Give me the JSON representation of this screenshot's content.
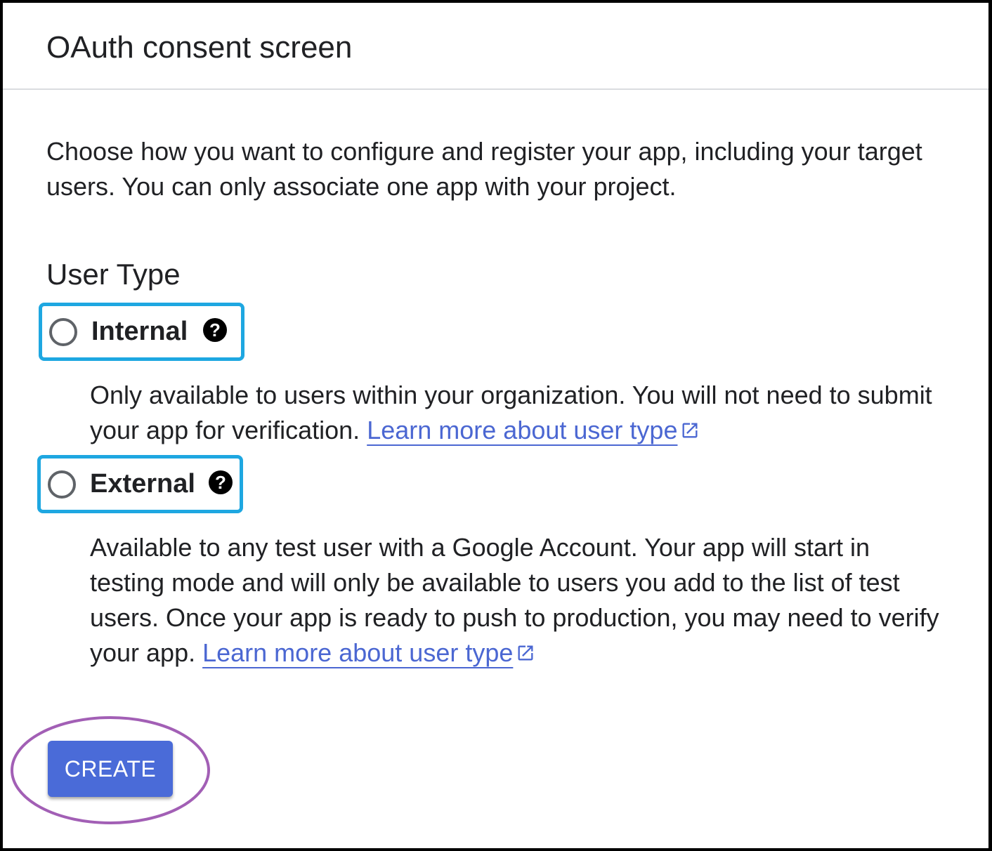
{
  "header": {
    "title": "OAuth consent screen"
  },
  "intro": {
    "text": "Choose how you want to configure and register your app, including your target users. You can only associate one app with your project."
  },
  "user_type": {
    "heading": "User Type",
    "options": [
      {
        "label": "Internal",
        "selected": false,
        "help_icon": "help-icon",
        "description": "Only available to users within your organization. You will not need to submit your app for verification.",
        "link_text": "Learn more about user type",
        "link_icon": "open-in-new-icon"
      },
      {
        "label": "External",
        "selected": false,
        "help_icon": "help-icon",
        "description": "Available to any test user with a Google Account. Your app will start in testing mode and will only be available to users you add to the list of test users. Once your app is ready to push to production, you may need to verify your app.",
        "link_text": "Learn more about user type",
        "link_icon": "open-in-new-icon"
      }
    ]
  },
  "actions": {
    "create_label": "CREATE"
  },
  "colors": {
    "option_highlight": "#1ea7e1",
    "button_highlight": "#a25fb5",
    "primary": "#4a6bd8",
    "link": "#4b67d2"
  }
}
